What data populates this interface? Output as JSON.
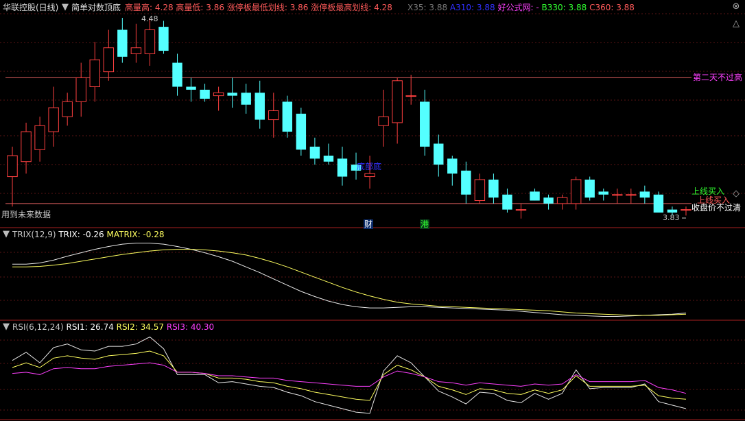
{
  "header": {
    "stock": "华联控股(日线)",
    "indicator": "简单对数顶底",
    "pairs": [
      {
        "label": "高量高:",
        "value": "4.28",
        "color": "#ff5a5a"
      },
      {
        "label": "高量低:",
        "value": "3.86",
        "color": "#ff5a5a"
      },
      {
        "label": "涨停板最低划线:",
        "value": "3.86",
        "color": "#ff5a5a"
      },
      {
        "label": "涨停板最高划线:",
        "value": "4.28",
        "color": "#ff5a5a"
      }
    ],
    "right": [
      {
        "label": "X35:",
        "value": "3.88",
        "color": "#777777"
      },
      {
        "label": "A310:",
        "value": "3.88",
        "color": "#3030ff"
      },
      {
        "label": "好公式网:",
        "value": "-",
        "color": "#ff40ff"
      },
      {
        "label": "B330:",
        "value": "3.88",
        "color": "#30ff30"
      },
      {
        "label": "C360:",
        "value": "3.88",
        "color": "#ff5a5a"
      }
    ]
  },
  "main": {
    "top_label": "4.48",
    "bottom_label": "3.83",
    "annotations": {
      "second_day": "第二天不过高",
      "buy_green": "上线买入",
      "buy_red": "上线买入",
      "close_price": "收盘价不过清",
      "future": "用到未来数据",
      "bottom_text": "底部底",
      "cai": "财",
      "gang": "港"
    }
  },
  "trix": {
    "title": "TRIX(12,9)",
    "v1": "TRIX: -0.26",
    "v2": "MATRIX: -0.28"
  },
  "rsi": {
    "title": "RSI(6,12,24)",
    "v1": "RSI1: 26.74",
    "v2": "RSI2: 34.57",
    "v3": "RSI3: 40.30"
  },
  "icons": [
    "close-icon",
    "up-arrow-icon",
    "down-arrow-icon",
    "collapse-icon"
  ],
  "chart_data": [
    {
      "type": "candlestick",
      "title": "华联控股(日线)",
      "ohlc": [
        [
          3.95,
          4.05,
          3.85,
          4.02
        ],
        [
          4.0,
          4.13,
          3.96,
          4.1
        ],
        [
          4.04,
          4.15,
          4.0,
          4.12
        ],
        [
          4.1,
          4.25,
          4.05,
          4.18
        ],
        [
          4.15,
          4.23,
          4.12,
          4.2
        ],
        [
          4.2,
          4.33,
          4.15,
          4.28
        ],
        [
          4.25,
          4.4,
          4.2,
          4.34
        ],
        [
          4.3,
          4.44,
          4.27,
          4.38
        ],
        [
          4.44,
          4.48,
          4.33,
          4.35
        ],
        [
          4.36,
          4.46,
          4.33,
          4.38
        ],
        [
          4.36,
          4.48,
          4.32,
          4.44
        ],
        [
          4.45,
          4.47,
          4.36,
          4.37
        ],
        [
          4.33,
          4.36,
          4.22,
          4.25
        ],
        [
          4.25,
          4.28,
          4.2,
          4.24
        ],
        [
          4.24,
          4.26,
          4.2,
          4.21
        ],
        [
          4.22,
          4.25,
          4.17,
          4.23
        ],
        [
          4.23,
          4.28,
          4.18,
          4.22
        ],
        [
          4.23,
          4.26,
          4.16,
          4.19
        ],
        [
          4.23,
          4.27,
          4.11,
          4.14
        ],
        [
          4.14,
          4.23,
          4.08,
          4.17
        ],
        [
          4.2,
          4.22,
          4.08,
          4.1
        ],
        [
          4.16,
          4.18,
          4.02,
          4.04
        ],
        [
          4.05,
          4.08,
          3.99,
          4.01
        ],
        [
          4.02,
          4.06,
          3.99,
          4.0
        ],
        [
          4.01,
          4.05,
          3.92,
          3.95
        ],
        [
          3.99,
          4.03,
          3.94,
          3.97
        ],
        [
          3.95,
          4.02,
          3.91,
          3.96
        ],
        [
          4.12,
          4.24,
          4.05,
          4.15
        ],
        [
          4.13,
          4.28,
          4.06,
          4.27
        ],
        [
          4.22,
          4.29,
          4.19,
          4.22
        ],
        [
          4.2,
          4.24,
          4.02,
          4.05
        ],
        [
          4.06,
          4.09,
          3.95,
          3.99
        ],
        [
          4.01,
          4.02,
          3.92,
          3.96
        ],
        [
          3.97,
          4.0,
          3.86,
          3.89
        ],
        [
          3.87,
          3.96,
          3.86,
          3.94
        ],
        [
          3.94,
          3.96,
          3.86,
          3.88
        ],
        [
          3.89,
          3.91,
          3.83,
          3.84
        ],
        [
          3.84,
          3.86,
          3.81,
          3.84
        ],
        [
          3.9,
          3.91,
          3.87,
          3.87
        ],
        [
          3.88,
          3.89,
          3.84,
          3.86
        ],
        [
          3.86,
          3.89,
          3.84,
          3.88
        ],
        [
          3.86,
          3.95,
          3.84,
          3.94
        ],
        [
          3.94,
          3.95,
          3.87,
          3.88
        ],
        [
          3.9,
          3.91,
          3.87,
          3.89
        ],
        [
          3.89,
          3.91,
          3.86,
          3.89
        ],
        [
          3.89,
          3.91,
          3.86,
          3.89
        ],
        [
          3.9,
          3.92,
          3.86,
          3.88
        ],
        [
          3.89,
          3.9,
          3.83,
          3.83
        ],
        [
          3.84,
          3.85,
          3.82,
          3.83
        ],
        [
          3.84,
          3.85,
          3.82,
          3.84
        ]
      ],
      "levels": [
        4.28,
        3.86
      ]
    },
    {
      "type": "line",
      "title": "TRIX(12,9)",
      "series": [
        {
          "name": "TRIX",
          "color": "#e8e8e8",
          "values": [
            0.6,
            0.6,
            0.62,
            0.67,
            0.74,
            0.8,
            0.86,
            0.91,
            0.95,
            0.97,
            0.97,
            0.95,
            0.91,
            0.86,
            0.8,
            0.73,
            0.65,
            0.55,
            0.45,
            0.34,
            0.23,
            0.12,
            0.03,
            -0.05,
            -0.11,
            -0.15,
            -0.17,
            -0.17,
            -0.16,
            -0.15,
            -0.15,
            -0.16,
            -0.17,
            -0.18,
            -0.19,
            -0.2,
            -0.21,
            -0.23,
            -0.25,
            -0.27,
            -0.29,
            -0.3,
            -0.31,
            -0.32,
            -0.32,
            -0.31,
            -0.3,
            -0.29,
            -0.28,
            -0.26
          ]
        },
        {
          "name": "MATRIX",
          "color": "#ffff60",
          "values": [
            0.55,
            0.55,
            0.56,
            0.58,
            0.61,
            0.65,
            0.69,
            0.73,
            0.77,
            0.8,
            0.83,
            0.85,
            0.86,
            0.86,
            0.85,
            0.83,
            0.8,
            0.76,
            0.7,
            0.63,
            0.55,
            0.46,
            0.37,
            0.28,
            0.19,
            0.11,
            0.04,
            -0.02,
            -0.07,
            -0.1,
            -0.12,
            -0.14,
            -0.15,
            -0.16,
            -0.17,
            -0.18,
            -0.19,
            -0.2,
            -0.21,
            -0.22,
            -0.24,
            -0.26,
            -0.27,
            -0.28,
            -0.29,
            -0.3,
            -0.3,
            -0.3,
            -0.29,
            -0.28
          ]
        }
      ]
    },
    {
      "type": "line",
      "title": "RSI(6,12,24)",
      "series": [
        {
          "name": "RSI1",
          "color": "#e8e8e8",
          "values": [
            68,
            75,
            66,
            79,
            82,
            77,
            76,
            80,
            80,
            82,
            88,
            78,
            56,
            56,
            56,
            49,
            50,
            48,
            46,
            45,
            41,
            38,
            33,
            30,
            27,
            24,
            23,
            59,
            72,
            66,
            54,
            42,
            37,
            31,
            41,
            40,
            34,
            32,
            40,
            35,
            40,
            60,
            44,
            45,
            45,
            45,
            48,
            33,
            30,
            27
          ]
        },
        {
          "name": "RSI2",
          "color": "#ffff60",
          "values": [
            62,
            66,
            62,
            70,
            72,
            70,
            69,
            72,
            73,
            74,
            76,
            72,
            58,
            58,
            57,
            53,
            53,
            52,
            50,
            49,
            46,
            44,
            41,
            39,
            37,
            35,
            34,
            56,
            64,
            60,
            54,
            46,
            43,
            39,
            44,
            43,
            40,
            39,
            43,
            40,
            43,
            55,
            46,
            46,
            46,
            46,
            47,
            38,
            36,
            35
          ]
        },
        {
          "name": "RSI3",
          "color": "#ff40ff",
          "values": [
            57,
            58,
            56,
            61,
            62,
            61,
            61,
            63,
            64,
            65,
            66,
            64,
            58,
            58,
            57,
            55,
            55,
            54,
            53,
            53,
            51,
            50,
            49,
            48,
            47,
            46,
            46,
            54,
            59,
            57,
            54,
            50,
            49,
            47,
            49,
            48,
            47,
            46,
            48,
            47,
            48,
            56,
            50,
            50,
            50,
            50,
            51,
            45,
            43,
            40
          ]
        }
      ]
    }
  ]
}
